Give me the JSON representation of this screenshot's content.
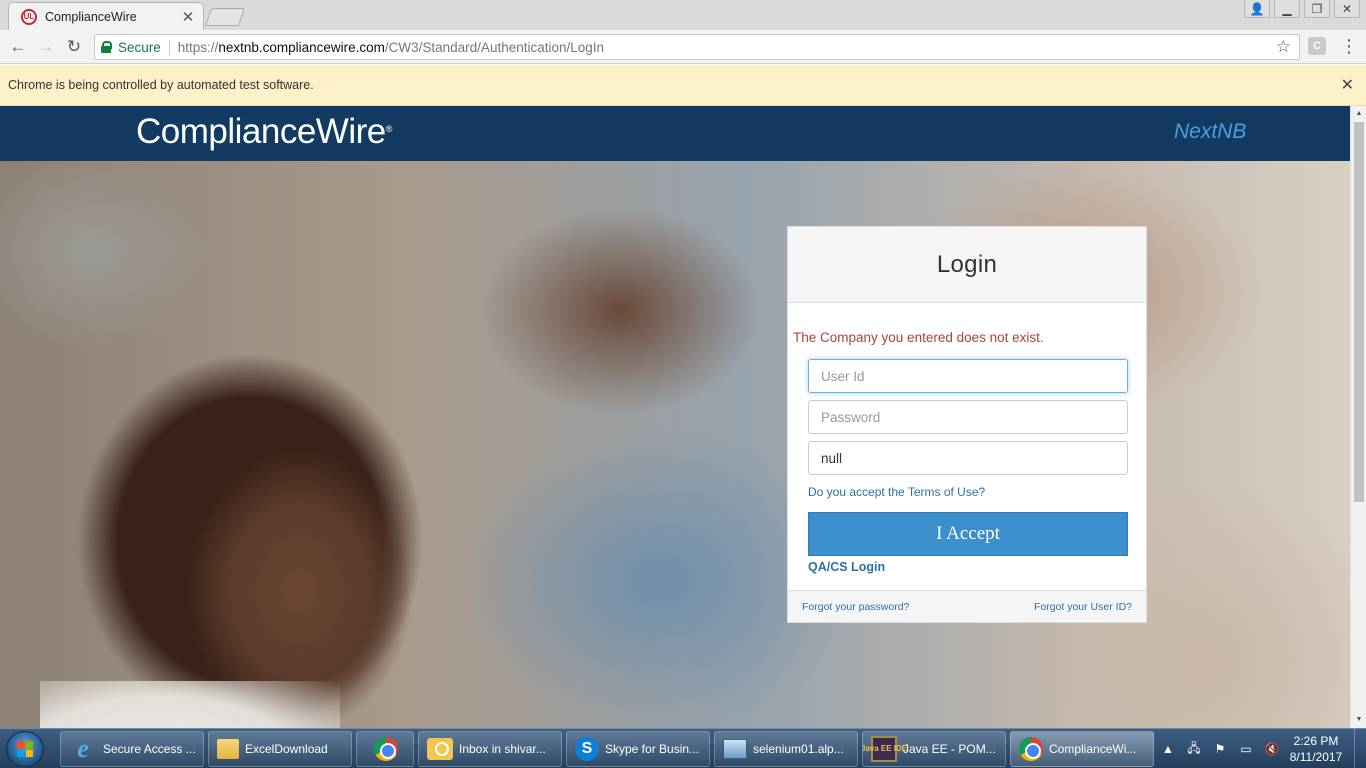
{
  "browser": {
    "tab": {
      "title": "ComplianceWire",
      "favicon": "UL"
    },
    "address": {
      "secure_label": "Secure",
      "url_scheme": "https://",
      "url_host": "nextnb.compliancewire.com",
      "url_path": "/CW3/Standard/Authentication/LogIn"
    },
    "extension_label": "C",
    "infobar_text": "Chrome is being controlled by automated test software."
  },
  "site": {
    "logo_text": "ComplianceWire",
    "logo_mark": "®",
    "site_name": "NextNB"
  },
  "login": {
    "title": "Login",
    "error": "The Company you entered does not exist.",
    "user_id_placeholder": "User Id",
    "password_placeholder": "Password",
    "company_value": "null",
    "terms_link": "Do you accept the Terms of Use?",
    "accept_button": "I Accept",
    "qacs_link": "QA/CS Login",
    "forgot_password": "Forgot your password?",
    "forgot_userid": "Forgot your User ID?"
  },
  "taskbar": {
    "items": [
      {
        "label": "Secure Access ...",
        "icon": "internet-explorer-icon"
      },
      {
        "label": "ExcelDownload",
        "icon": "folder-icon"
      },
      {
        "label": "",
        "icon": "chrome-icon"
      },
      {
        "label": "Inbox in shivar...",
        "icon": "outlook-icon"
      },
      {
        "label": "Skype for Busin...",
        "icon": "skype-icon"
      },
      {
        "label": "selenium01.alp...",
        "icon": "remote-desktop-icon"
      },
      {
        "label": "Java EE - POM...",
        "icon": "eclipse-java-ee-icon"
      },
      {
        "label": "ComplianceWi...",
        "icon": "chrome-icon"
      }
    ],
    "java_icon_text": "Java EE IDE",
    "clock_time": "2:26 PM",
    "clock_date": "8/11/2017"
  },
  "colors": {
    "header_bg": "#133a61",
    "site_name": "#4b9edc",
    "accept_button": "#3c8fcd",
    "error_text": "#a94442",
    "link": "#2f6fa8",
    "infobar_bg": "#fdf2c7"
  }
}
